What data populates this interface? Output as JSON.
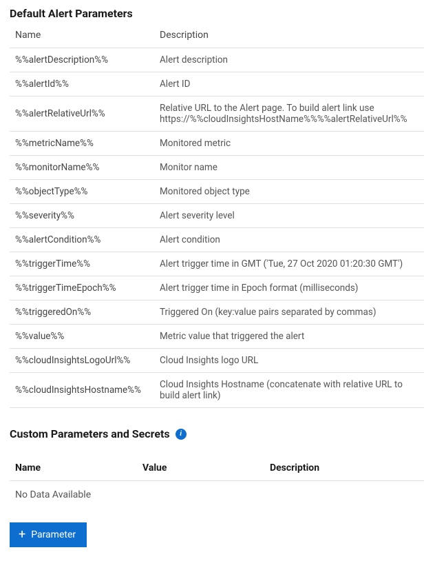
{
  "defaultParams": {
    "title": "Default Alert Parameters",
    "headers": {
      "name": "Name",
      "description": "Description"
    },
    "rows": [
      {
        "name": "%%alertDescription%%",
        "description": "Alert description"
      },
      {
        "name": "%%alertId%%",
        "description": "Alert ID"
      },
      {
        "name": "%%alertRelativeUrl%%",
        "description": "Relative URL to the Alert page. To build alert link use https://%%cloudInsightsHostName%%%%alertRelativeUrl%%"
      },
      {
        "name": "%%metricName%%",
        "description": "Monitored metric"
      },
      {
        "name": "%%monitorName%%",
        "description": "Monitor name"
      },
      {
        "name": "%%objectType%%",
        "description": "Monitored object type"
      },
      {
        "name": "%%severity%%",
        "description": "Alert severity level"
      },
      {
        "name": "%%alertCondition%%",
        "description": "Alert condition"
      },
      {
        "name": "%%triggerTime%%",
        "description": "Alert trigger time in GMT ('Tue, 27 Oct 2020 01:20:30 GMT')"
      },
      {
        "name": "%%triggerTimeEpoch%%",
        "description": "Alert trigger time in Epoch format (milliseconds)"
      },
      {
        "name": "%%triggeredOn%%",
        "description": "Triggered On (key:value pairs separated by commas)"
      },
      {
        "name": "%%value%%",
        "description": "Metric value that triggered the alert"
      },
      {
        "name": "%%cloudInsightsLogoUrl%%",
        "description": "Cloud Insights logo URL"
      },
      {
        "name": "%%cloudInsightsHostname%%",
        "description": "Cloud Insights Hostname (concatenate with relative URL to build alert link)"
      }
    ]
  },
  "customParams": {
    "title": "Custom Parameters and Secrets",
    "headers": {
      "name": "Name",
      "value": "Value",
      "description": "Description"
    },
    "emptyMessage": "No Data Available",
    "addButton": "Parameter"
  }
}
